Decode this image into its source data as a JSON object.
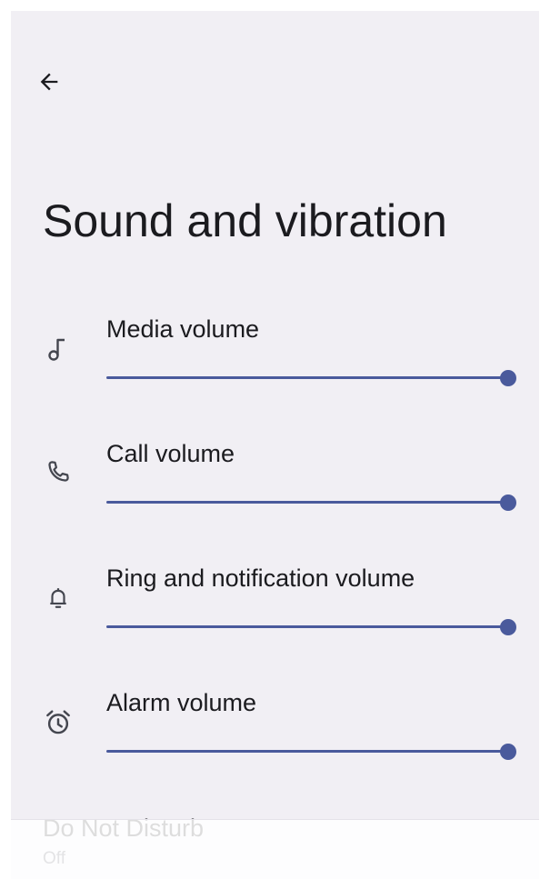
{
  "header": {
    "title": "Sound and vibration",
    "back_icon": "arrow-back-icon"
  },
  "volumes": [
    {
      "label": "Media volume",
      "icon": "music-note-icon",
      "level": 1.0
    },
    {
      "label": "Call volume",
      "icon": "phone-icon",
      "level": 1.0
    },
    {
      "label": "Ring and notification volume",
      "icon": "bell-icon",
      "level": 1.0
    },
    {
      "label": "Alarm volume",
      "icon": "alarm-clock-icon",
      "level": 1.0
    }
  ],
  "dnd": {
    "title": "Do Not Disturb",
    "summary": "Off"
  },
  "colors": {
    "background": "#f1eff4",
    "accent": "#4a5a9c",
    "text": "#1b1b1f"
  }
}
